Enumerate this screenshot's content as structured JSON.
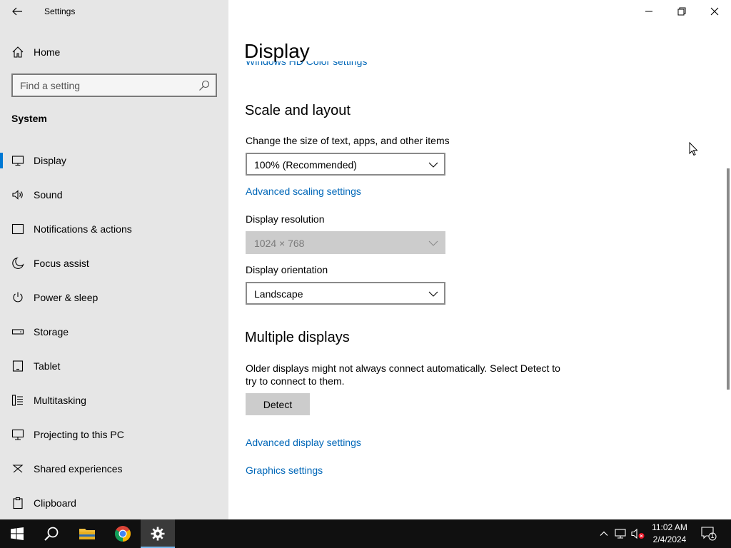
{
  "window": {
    "app_title": "Settings"
  },
  "sidebar": {
    "home_label": "Home",
    "search_placeholder": "Find a setting",
    "section": "System",
    "items": [
      {
        "label": "Display",
        "icon": "monitor-icon",
        "selected": true
      },
      {
        "label": "Sound",
        "icon": "speaker-icon"
      },
      {
        "label": "Notifications & actions",
        "icon": "notification-icon"
      },
      {
        "label": "Focus assist",
        "icon": "moon-icon"
      },
      {
        "label": "Power & sleep",
        "icon": "power-icon"
      },
      {
        "label": "Storage",
        "icon": "storage-icon"
      },
      {
        "label": "Tablet",
        "icon": "tablet-icon"
      },
      {
        "label": "Multitasking",
        "icon": "multitasking-icon"
      },
      {
        "label": "Projecting to this PC",
        "icon": "projecting-icon"
      },
      {
        "label": "Shared experiences",
        "icon": "shared-experiences-icon"
      },
      {
        "label": "Clipboard",
        "icon": "clipboard-icon"
      }
    ]
  },
  "main": {
    "page_title": "Display",
    "clipped_link": "Windows HD Color settings",
    "scale_layout": {
      "heading": "Scale and layout",
      "size_label": "Change the size of text, apps, and other items",
      "size_value": "100% (Recommended)",
      "advanced_scaling_link": "Advanced scaling settings",
      "resolution_label": "Display resolution",
      "resolution_value": "1024 × 768",
      "orientation_label": "Display orientation",
      "orientation_value": "Landscape"
    },
    "multiple_displays": {
      "heading": "Multiple displays",
      "description_line1": "Older displays might not always connect automatically. Select Detect to",
      "description_line2": "try to connect to them.",
      "detect_button": "Detect",
      "advanced_display_link": "Advanced display settings",
      "graphics_link": "Graphics settings"
    }
  },
  "taskbar": {
    "time": "11:02 AM",
    "date": "2/4/2024",
    "notification_count": "1"
  },
  "colors": {
    "accent": "#0078d4",
    "link": "#0067b8",
    "sidebar_bg": "#e6e6e6",
    "taskbar_bg": "#101010"
  }
}
